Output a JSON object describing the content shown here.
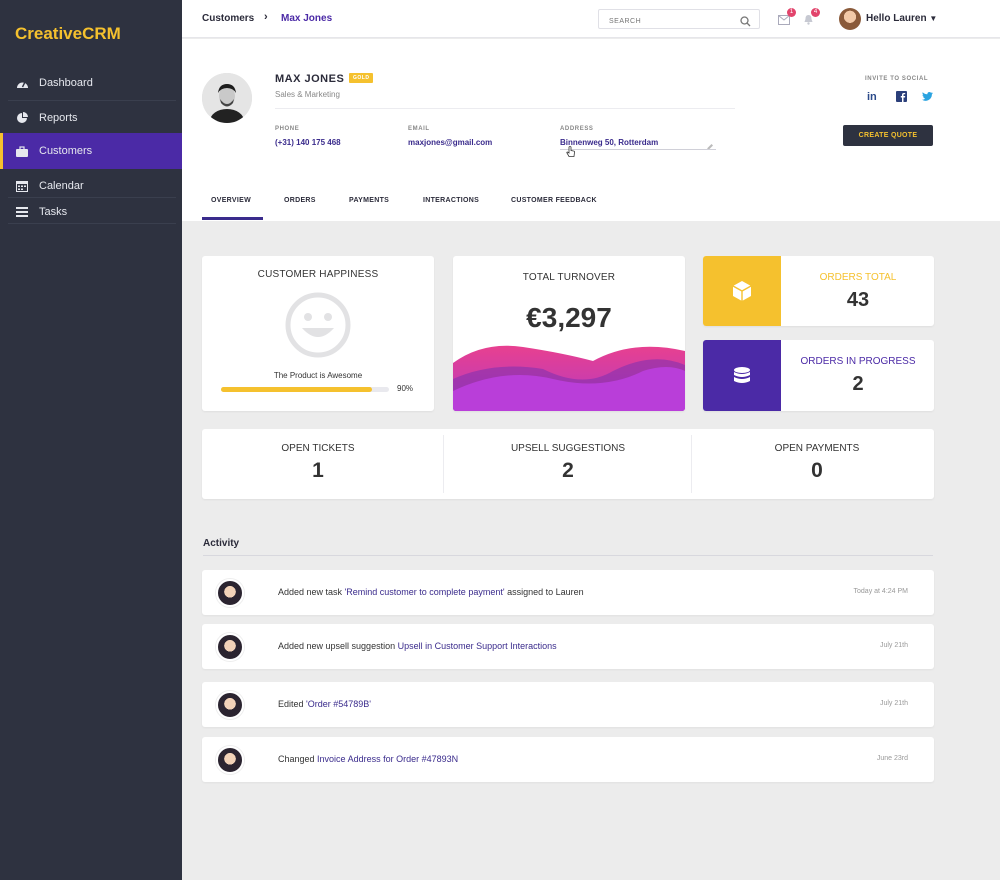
{
  "app": {
    "logo": "CreativeCRM"
  },
  "sidebar": {
    "items": [
      {
        "label": "Dashboard",
        "icon": "dashboard-gauge-icon",
        "active": false
      },
      {
        "label": "Reports",
        "icon": "pie-chart-icon",
        "active": false
      },
      {
        "label": "Customers",
        "icon": "briefcase-icon",
        "active": true
      },
      {
        "label": "Calendar",
        "icon": "calendar-icon",
        "active": false
      },
      {
        "label": "Tasks",
        "icon": "tasks-list-icon",
        "active": false
      }
    ]
  },
  "topbar": {
    "breadcrumb": [
      "Customers",
      "Max Jones"
    ],
    "search_placeholder": "SEARCH",
    "messages_badge": "1",
    "notifications_badge": "4",
    "user_greeting": "Hello Lauren"
  },
  "profile": {
    "name": "MAX JONES",
    "tier": "GOLD",
    "role": "Sales & Marketing",
    "phone_label": "PHONE",
    "phone": "(+31) 140 175 468",
    "email_label": "EMAIL",
    "email": "maxjones@gmail.com",
    "address_label": "ADDRESS",
    "address": "Binnenweg 50, Rotterdam",
    "invite_label": "INVITE TO SOCIAL",
    "create_quote": "CREATE QUOTE"
  },
  "tabs": [
    "OVERVIEW",
    "ORDERS",
    "PAYMENTS",
    "INTERACTIONS",
    "CUSTOMER FEEDBACK"
  ],
  "cards": {
    "happiness": {
      "title": "CUSTOMER HAPPINESS",
      "label": "The Product is Awesome",
      "percent_text": "90%",
      "percent": 0.9
    },
    "turnover": {
      "title": "TOTAL TURNOVER",
      "value": "€3,297"
    },
    "orders_total": {
      "label": "ORDERS TOTAL",
      "value": "43"
    },
    "orders_in_progress": {
      "label": "ORDERS IN PROGRESS",
      "value": "2"
    },
    "open_tickets": {
      "label": "OPEN TICKETS",
      "value": "1"
    },
    "upsell": {
      "label": "UPSELL SUGGESTIONS",
      "value": "2"
    },
    "open_payments": {
      "label": "OPEN PAYMENTS",
      "value": "0"
    }
  },
  "activity": {
    "title": "Activity",
    "items": [
      {
        "pre": "Added new task ",
        "link": "'Remind customer to complete payment'",
        "post": " assigned to Lauren",
        "time": "Today at 4:24 PM"
      },
      {
        "pre": "Added new upsell suggestion ",
        "link": "Upsell in Customer Support Interactions",
        "post": "",
        "time": "July 21th"
      },
      {
        "pre": "Edited ",
        "link": "'Order #54789B'",
        "post": "",
        "time": "July 21th"
      },
      {
        "pre": "Changed ",
        "link": "Invoice Address for Order #47893N",
        "post": "",
        "time": "June 23rd"
      }
    ]
  },
  "colors": {
    "sidebar": "#2e3240",
    "accent_purple": "#4b2aa6",
    "accent_yellow": "#f5c12e",
    "link": "#3a2b8c"
  }
}
